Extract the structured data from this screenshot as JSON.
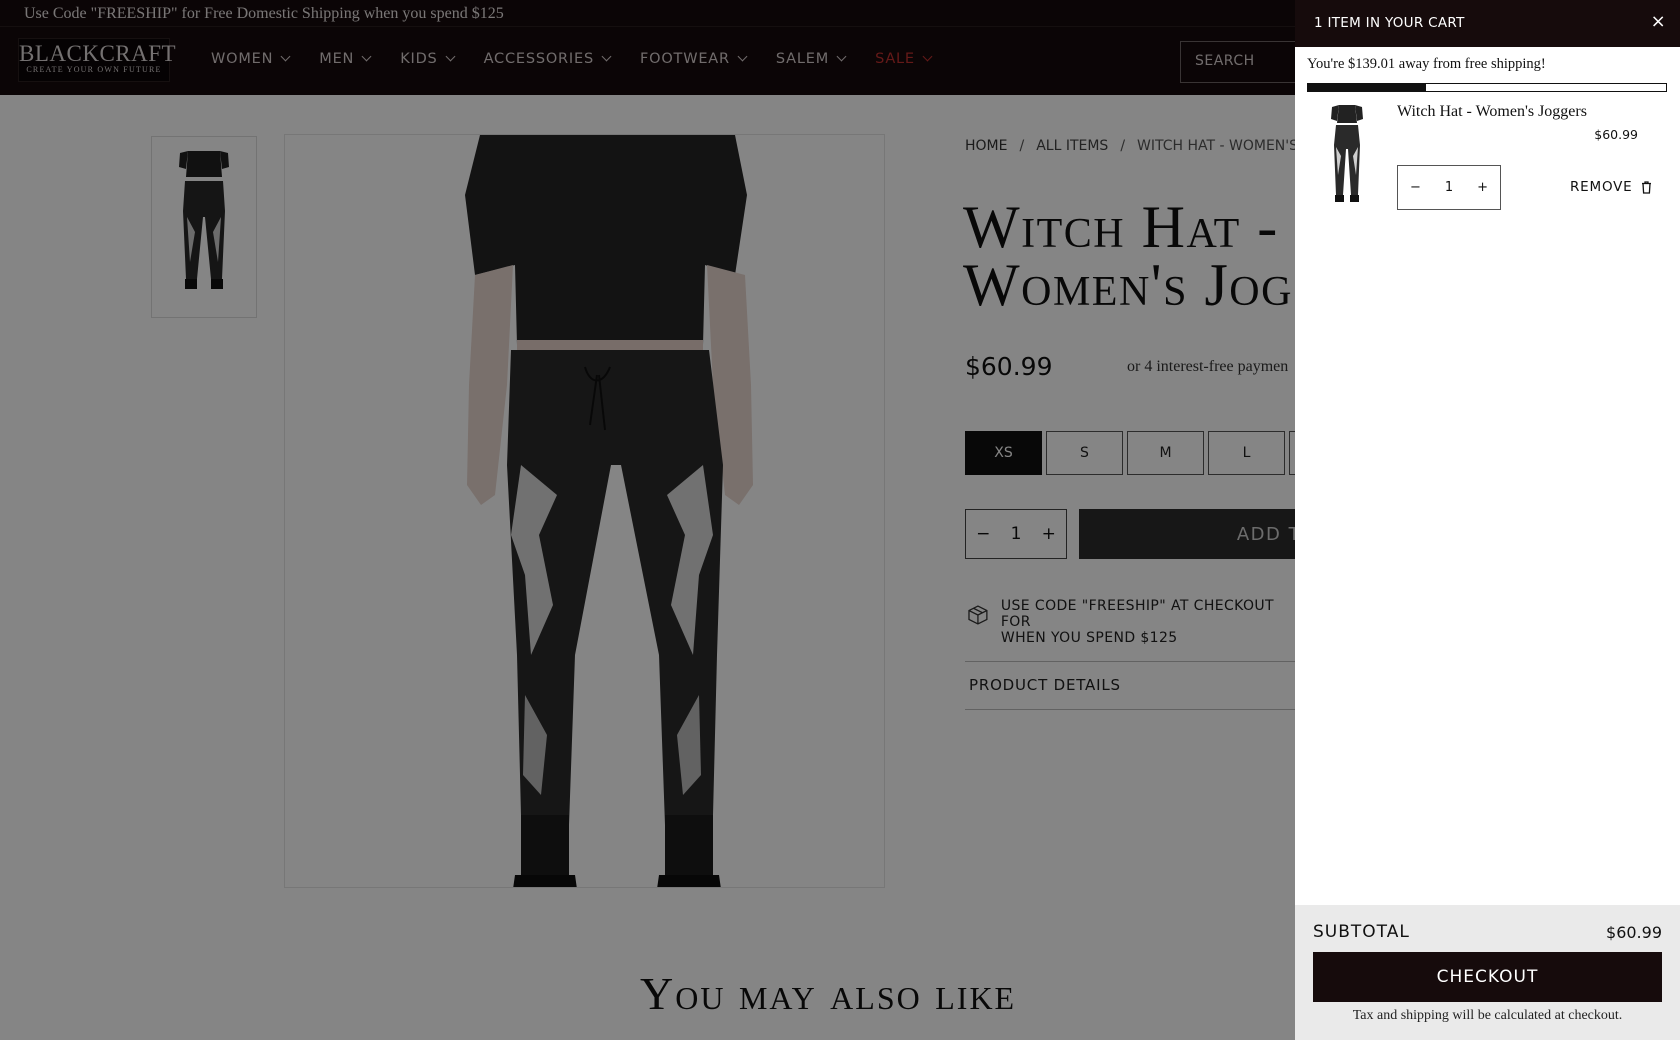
{
  "promo_bar": {
    "text": "Use Code \"FREESHIP\" for Free Domestic Shipping when you spend $125"
  },
  "header": {
    "logo": {
      "main": "BLACKCRAFT",
      "tagline": "CREATE YOUR OWN FUTURE"
    },
    "nav": [
      "WOMEN",
      "MEN",
      "KIDS",
      "ACCESSORIES",
      "FOOTWEAR",
      "SALEM",
      "SALE"
    ],
    "search_placeholder": "SEARCH",
    "sale_color": "#c0312f",
    "bar_color": "#160b0c"
  },
  "breadcrumb": [
    "HOME",
    "ALL ITEMS",
    "WITCH HAT - WOMEN'S J"
  ],
  "product": {
    "title_line1": "Witch Hat -",
    "title_line2": "Women's Jog",
    "price": "$60.99",
    "installments": "or 4 interest-free paymen",
    "sizes": [
      "XS",
      "S",
      "M",
      "L"
    ],
    "selected_size": "XS",
    "quantity": "1",
    "add_to_cart": "ADD T",
    "shipping_line1": "USE CODE \"FREESHIP\" AT CHECKOUT FOR",
    "shipping_line2": "WHEN YOU SPEND $125",
    "details_label": "PRODUCT DETAILS",
    "shipping_icon": "box-icon"
  },
  "also_like": "You may also like",
  "cart": {
    "header": "1 ITEM IN YOUR CART",
    "close": "×",
    "shipping_message": "You're $139.01 away from free shipping!",
    "shipping_progress": 0.33,
    "item": {
      "name": "Witch Hat - Women's Joggers",
      "price": "$60.99",
      "quantity": "1",
      "remove_label": "REMOVE",
      "remove_icon": "trash-icon"
    },
    "subtotal_label": "SUBTOTAL",
    "subtotal_value": "$60.99",
    "checkout_label": "CHECKOUT",
    "tax_note": "Tax and shipping will be calculated at checkout."
  },
  "icons": {
    "minus": "−",
    "plus": "+"
  }
}
